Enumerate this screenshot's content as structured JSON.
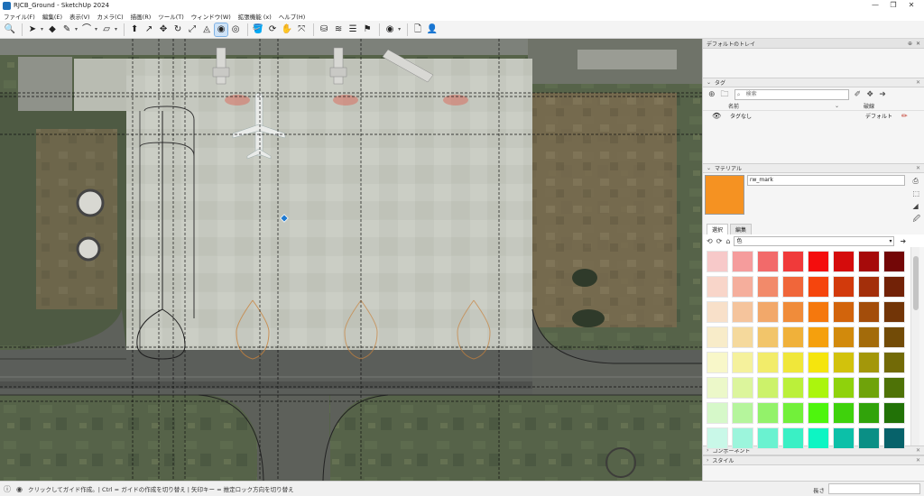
{
  "window": {
    "title": "RJCB_Ground - SketchUp 2024",
    "controls": [
      "—",
      "❐",
      "✕"
    ]
  },
  "menu": [
    "ファイル(F)",
    "編集(E)",
    "表示(V)",
    "カメラ(C)",
    "描画(R)",
    "ツール(T)",
    "ウィンドウ(W)",
    "拡張機能 (x)",
    "ヘルプ(H)"
  ],
  "toolbar": {
    "tools": [
      {
        "name": "zoom-icon",
        "glyph": "🔍"
      },
      {
        "name": "select-arrow-icon",
        "glyph": "➤"
      },
      {
        "name": "eraser-icon",
        "glyph": "◆"
      },
      {
        "name": "pencil-line-icon",
        "glyph": "✎"
      },
      {
        "name": "arc-icon",
        "glyph": "⌒"
      },
      {
        "name": "rectangle-icon",
        "glyph": "▱"
      },
      {
        "name": "push-pull-icon",
        "glyph": "⬆"
      },
      {
        "name": "follow-me-icon",
        "glyph": "↗"
      },
      {
        "name": "move-icon",
        "glyph": "✥"
      },
      {
        "name": "rotate-icon",
        "glyph": "↻"
      },
      {
        "name": "scale-icon",
        "glyph": "⤢"
      },
      {
        "name": "protractor-icon",
        "glyph": "◬"
      },
      {
        "name": "tape-measure-icon",
        "glyph": "◉"
      },
      {
        "name": "offset-icon",
        "glyph": "◎"
      },
      {
        "name": "paint-bucket-icon",
        "glyph": "🪣"
      },
      {
        "name": "orbit-icon",
        "glyph": "⟳"
      },
      {
        "name": "pan-icon",
        "glyph": "✋"
      },
      {
        "name": "zoom-extents-icon",
        "glyph": "⤧"
      },
      {
        "name": "warehouse-icon",
        "glyph": "⛁"
      },
      {
        "name": "sandbox-icon",
        "glyph": "≋"
      },
      {
        "name": "layers-icon",
        "glyph": "☰"
      },
      {
        "name": "styles-icon",
        "glyph": "⚑"
      },
      {
        "name": "account-icon",
        "glyph": "◉"
      },
      {
        "name": "document-icon",
        "glyph": "🗋"
      },
      {
        "name": "person-icon",
        "glyph": "👤"
      }
    ]
  },
  "tray": {
    "title": "デフォルトのトレイ",
    "header_controls": [
      "⊕",
      "✕"
    ]
  },
  "tags": {
    "panel_title": "タグ",
    "search_placeholder": "検索",
    "col_name": "名前",
    "col_dash": "破線",
    "rows": [
      {
        "name": "タグなし",
        "dash": "デフォルト"
      }
    ]
  },
  "materials": {
    "panel_title": "マテリアル",
    "name": "rw_mark",
    "swatch_color": "#f59222",
    "tabs": [
      "選択",
      "編集"
    ],
    "collection": "色",
    "palette": [
      [
        "#f7c9c9",
        "#f59c9c",
        "#f26a6a",
        "#f03a3a",
        "#f40d0d",
        "#d50c0c",
        "#a60a0a",
        "#730707"
      ],
      [
        "#f8d5c9",
        "#f5ae9c",
        "#f28a6a",
        "#f0663a",
        "#f5450d",
        "#d23a0c",
        "#a32f0a",
        "#722207"
      ],
      [
        "#f8e0c9",
        "#f5c49c",
        "#f2a86a",
        "#f08c3a",
        "#f5780d",
        "#d2640c",
        "#a34d0a",
        "#723507"
      ],
      [
        "#f8ecc9",
        "#f5d99c",
        "#f2c56a",
        "#f0b13a",
        "#f5a00d",
        "#d28a0c",
        "#a36b0a",
        "#724b07"
      ],
      [
        "#f8f7c9",
        "#f5f19c",
        "#f2ec6a",
        "#f0e73a",
        "#f5e50d",
        "#d2c20c",
        "#a3970a",
        "#726a07"
      ],
      [
        "#ecf8c9",
        "#dcf59c",
        "#ccf26a",
        "#bbf03a",
        "#abf50d",
        "#8fd20c",
        "#6fa30a",
        "#4e7207"
      ],
      [
        "#d6f8c9",
        "#b5f59c",
        "#93f26a",
        "#72f03a",
        "#4ef50d",
        "#3fd20c",
        "#31a30a",
        "#227207"
      ],
      [
        "#c9f8e8",
        "#9cf5dc",
        "#6af2d0",
        "#3af0c5",
        "#0df5c3",
        "#0cc0a8",
        "#0a8f85",
        "#07626a"
      ]
    ]
  },
  "collapsed_panels": [
    "コンポーネント",
    "スタイル"
  ],
  "status": {
    "text": "クリックしてガイド作成。| Ctrl = ガイドの作成を切り替え | 矢印キー = 推定ロック方向を切り替え",
    "length_label": "長さ"
  }
}
